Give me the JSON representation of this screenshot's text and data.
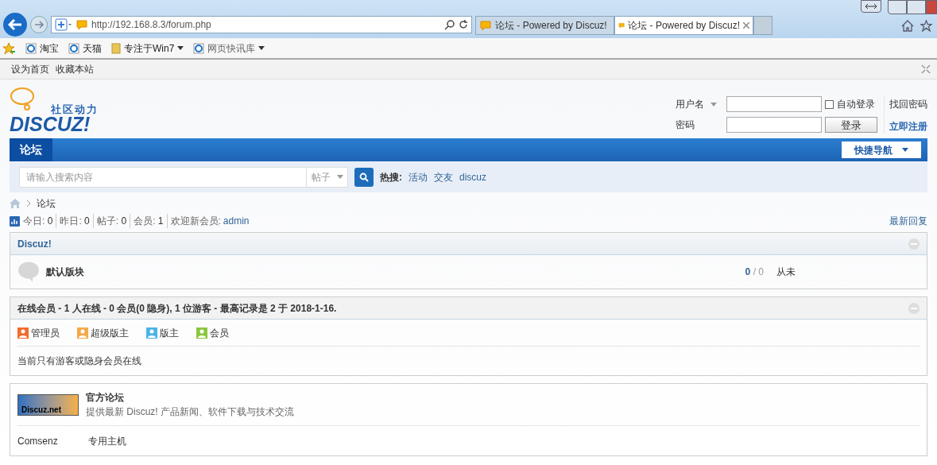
{
  "browser": {
    "address": "http://192.168.8.3/forum.php",
    "tabs": [
      {
        "title": "论坛 - Powered by Discuz!",
        "selected": false
      },
      {
        "title": "论坛 - Powered by Discuz!",
        "selected": true
      }
    ],
    "favorites": [
      {
        "label": "淘宝",
        "kind": "link"
      },
      {
        "label": "天猫",
        "kind": "link"
      },
      {
        "label": "专注于Win7",
        "kind": "folder"
      },
      {
        "label": "网页快讯库",
        "kind": "feed"
      }
    ]
  },
  "top_links": [
    "设为首页",
    "收藏本站"
  ],
  "logo": {
    "tagline": "社区动力",
    "wordmark": "DISCUZ!"
  },
  "login": {
    "username_label": "用户名",
    "password_label": "密码",
    "auto_login": {
      "label": "自动登录",
      "checked": false
    },
    "button": "登录",
    "forgot": "找回密码",
    "register": "立即注册"
  },
  "nav": {
    "tabs": [
      {
        "label": "论坛",
        "selected": true
      }
    ],
    "quick_nav": "快捷导航"
  },
  "search": {
    "placeholder": "请输入搜索内容",
    "type": "帖子",
    "hot_label": "热搜:",
    "hot": [
      "活动",
      "交友",
      "discuz"
    ]
  },
  "breadcrumb": [
    "论坛"
  ],
  "stats": {
    "items": [
      {
        "label": "今日:",
        "value": "0"
      },
      {
        "label": "昨日:",
        "value": "0"
      },
      {
        "label": "帖子:",
        "value": "0"
      },
      {
        "label": "会员:",
        "value": "1"
      }
    ],
    "welcome_label": "欢迎新会员:",
    "welcome_user": "admin",
    "latest": "最新回复"
  },
  "category": {
    "title": "Discuz!",
    "forums": [
      {
        "name": "默认版块",
        "threads": "0",
        "separator": "/",
        "posts": "0",
        "last": "从未"
      }
    ]
  },
  "online": {
    "title": "在线会员 - 1 人在线 - 0 会员(0 隐身), 1 位游客 - 最高记录是 2 于 2018-1-16.",
    "legend": [
      {
        "label": "管理员",
        "color": "#f26c2c"
      },
      {
        "label": "超级版主",
        "color": "#f5a94a"
      },
      {
        "label": "版主",
        "color": "#4ab4e6"
      },
      {
        "label": "会员",
        "color": "#8cc63e"
      }
    ],
    "message": "当前只有游客或隐身会员在线"
  },
  "links": {
    "logo_text": "Discuz.net",
    "name": "官方论坛",
    "desc": "提供最新 Discuz! 产品新闻、软件下载与技术交流",
    "text_links": [
      "Comsenz",
      "专用主机"
    ]
  }
}
